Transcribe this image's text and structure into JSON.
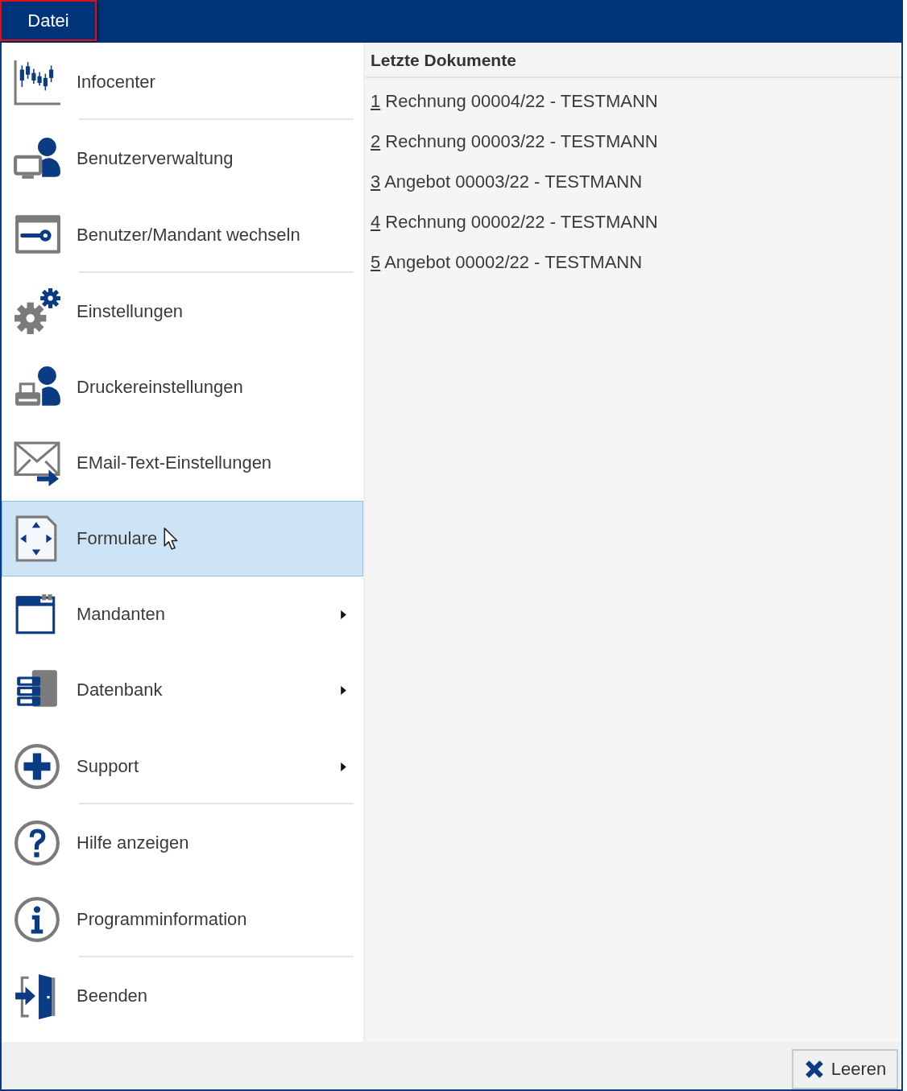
{
  "menu_bar": {
    "tabs": [
      {
        "label": "Datei",
        "selected": true
      }
    ]
  },
  "menu": {
    "items": [
      {
        "label": "Infocenter",
        "selected": false,
        "submenu": false,
        "separator_after": true
      },
      {
        "label": "Benutzerverwaltung",
        "selected": false,
        "submenu": false,
        "separator_after": false
      },
      {
        "label": "Benutzer/Mandant wechseln",
        "selected": false,
        "submenu": false,
        "separator_after": true
      },
      {
        "label": "Einstellungen",
        "selected": false,
        "submenu": false,
        "separator_after": false
      },
      {
        "label": "Druckereinstellungen",
        "selected": false,
        "submenu": false,
        "separator_after": false
      },
      {
        "label": "EMail-Text-Einstellungen",
        "selected": false,
        "submenu": false,
        "separator_after": false
      },
      {
        "label": "Formulare",
        "selected": true,
        "submenu": false,
        "separator_after": false
      },
      {
        "label": "Mandanten",
        "selected": false,
        "submenu": true,
        "separator_after": false
      },
      {
        "label": "Datenbank",
        "selected": false,
        "submenu": true,
        "separator_after": false
      },
      {
        "label": "Support",
        "selected": false,
        "submenu": true,
        "separator_after": true
      },
      {
        "label": "Hilfe anzeigen",
        "selected": false,
        "submenu": false,
        "separator_after": false
      },
      {
        "label": "Programminformation",
        "selected": false,
        "submenu": false,
        "separator_after": true
      },
      {
        "label": "Beenden",
        "selected": false,
        "submenu": false,
        "separator_after": false
      }
    ]
  },
  "recent_documents": {
    "title": "Letzte Dokumente",
    "items": [
      {
        "key": "1",
        "title": "Rechnung 00004/22 - TESTMANN"
      },
      {
        "key": "2",
        "title": "Rechnung 00003/22 - TESTMANN"
      },
      {
        "key": "3",
        "title": "Angebot 00003/22 - TESTMANN"
      },
      {
        "key": "4",
        "title": "Rechnung 00002/22 - TESTMANN"
      },
      {
        "key": "5",
        "title": "Angebot 00002/22 - TESTMANN"
      }
    ]
  },
  "footer": {
    "buttons": [
      {
        "label": "Leeren"
      }
    ]
  }
}
